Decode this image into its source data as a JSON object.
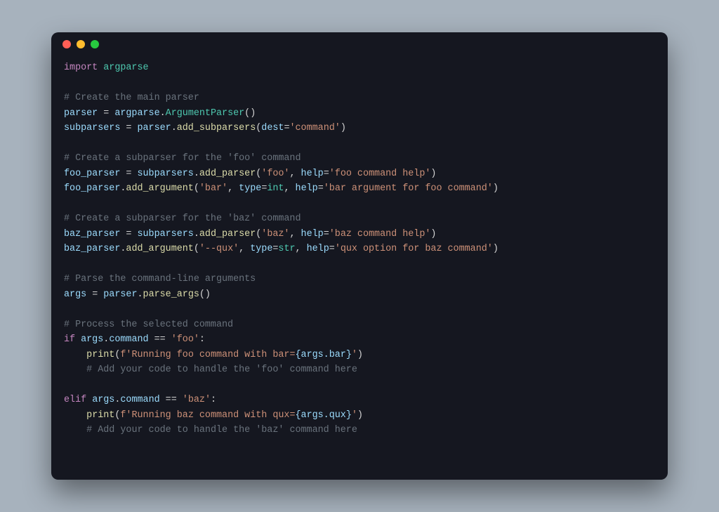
{
  "window": {
    "traffic_lights": [
      "close",
      "minimize",
      "zoom"
    ]
  },
  "code": {
    "lines": [
      [
        {
          "t": "import ",
          "c": "tk-kw"
        },
        {
          "t": "argparse",
          "c": "tk-mod"
        }
      ],
      [],
      [
        {
          "t": "# Create the main parser",
          "c": "tk-comment"
        }
      ],
      [
        {
          "t": "parser",
          "c": "tk-ident"
        },
        {
          "t": " = ",
          "c": "tk-op"
        },
        {
          "t": "argparse",
          "c": "tk-ident"
        },
        {
          "t": ".",
          "c": "tk-op"
        },
        {
          "t": "ArgumentParser",
          "c": "tk-mod"
        },
        {
          "t": "()",
          "c": "tk-op"
        }
      ],
      [
        {
          "t": "subparsers",
          "c": "tk-ident"
        },
        {
          "t": " = ",
          "c": "tk-op"
        },
        {
          "t": "parser",
          "c": "tk-ident"
        },
        {
          "t": ".",
          "c": "tk-op"
        },
        {
          "t": "add_subparsers",
          "c": "tk-func"
        },
        {
          "t": "(",
          "c": "tk-op"
        },
        {
          "t": "dest",
          "c": "tk-param"
        },
        {
          "t": "=",
          "c": "tk-op"
        },
        {
          "t": "'command'",
          "c": "tk-str"
        },
        {
          "t": ")",
          "c": "tk-op"
        }
      ],
      [],
      [
        {
          "t": "# Create a subparser for the 'foo' command",
          "c": "tk-comment"
        }
      ],
      [
        {
          "t": "foo_parser",
          "c": "tk-ident"
        },
        {
          "t": " = ",
          "c": "tk-op"
        },
        {
          "t": "subparsers",
          "c": "tk-ident"
        },
        {
          "t": ".",
          "c": "tk-op"
        },
        {
          "t": "add_parser",
          "c": "tk-func"
        },
        {
          "t": "(",
          "c": "tk-op"
        },
        {
          "t": "'foo'",
          "c": "tk-str"
        },
        {
          "t": ", ",
          "c": "tk-op"
        },
        {
          "t": "help",
          "c": "tk-param"
        },
        {
          "t": "=",
          "c": "tk-op"
        },
        {
          "t": "'foo command help'",
          "c": "tk-str"
        },
        {
          "t": ")",
          "c": "tk-op"
        }
      ],
      [
        {
          "t": "foo_parser",
          "c": "tk-ident"
        },
        {
          "t": ".",
          "c": "tk-op"
        },
        {
          "t": "add_argument",
          "c": "tk-func"
        },
        {
          "t": "(",
          "c": "tk-op"
        },
        {
          "t": "'bar'",
          "c": "tk-str"
        },
        {
          "t": ", ",
          "c": "tk-op"
        },
        {
          "t": "type",
          "c": "tk-param"
        },
        {
          "t": "=",
          "c": "tk-op"
        },
        {
          "t": "int",
          "c": "tk-mod"
        },
        {
          "t": ", ",
          "c": "tk-op"
        },
        {
          "t": "help",
          "c": "tk-param"
        },
        {
          "t": "=",
          "c": "tk-op"
        },
        {
          "t": "'bar argument for foo command'",
          "c": "tk-str"
        },
        {
          "t": ")",
          "c": "tk-op"
        }
      ],
      [],
      [
        {
          "t": "# Create a subparser for the 'baz' command",
          "c": "tk-comment"
        }
      ],
      [
        {
          "t": "baz_parser",
          "c": "tk-ident"
        },
        {
          "t": " = ",
          "c": "tk-op"
        },
        {
          "t": "subparsers",
          "c": "tk-ident"
        },
        {
          "t": ".",
          "c": "tk-op"
        },
        {
          "t": "add_parser",
          "c": "tk-func"
        },
        {
          "t": "(",
          "c": "tk-op"
        },
        {
          "t": "'baz'",
          "c": "tk-str"
        },
        {
          "t": ", ",
          "c": "tk-op"
        },
        {
          "t": "help",
          "c": "tk-param"
        },
        {
          "t": "=",
          "c": "tk-op"
        },
        {
          "t": "'baz command help'",
          "c": "tk-str"
        },
        {
          "t": ")",
          "c": "tk-op"
        }
      ],
      [
        {
          "t": "baz_parser",
          "c": "tk-ident"
        },
        {
          "t": ".",
          "c": "tk-op"
        },
        {
          "t": "add_argument",
          "c": "tk-func"
        },
        {
          "t": "(",
          "c": "tk-op"
        },
        {
          "t": "'--qux'",
          "c": "tk-str"
        },
        {
          "t": ", ",
          "c": "tk-op"
        },
        {
          "t": "type",
          "c": "tk-param"
        },
        {
          "t": "=",
          "c": "tk-op"
        },
        {
          "t": "str",
          "c": "tk-mod"
        },
        {
          "t": ", ",
          "c": "tk-op"
        },
        {
          "t": "help",
          "c": "tk-param"
        },
        {
          "t": "=",
          "c": "tk-op"
        },
        {
          "t": "'qux option for baz command'",
          "c": "tk-str"
        },
        {
          "t": ")",
          "c": "tk-op"
        }
      ],
      [],
      [
        {
          "t": "# Parse the command-line arguments",
          "c": "tk-comment"
        }
      ],
      [
        {
          "t": "args",
          "c": "tk-ident"
        },
        {
          "t": " = ",
          "c": "tk-op"
        },
        {
          "t": "parser",
          "c": "tk-ident"
        },
        {
          "t": ".",
          "c": "tk-op"
        },
        {
          "t": "parse_args",
          "c": "tk-func"
        },
        {
          "t": "()",
          "c": "tk-op"
        }
      ],
      [],
      [
        {
          "t": "# Process the selected command",
          "c": "tk-comment"
        }
      ],
      [
        {
          "t": "if ",
          "c": "tk-kw"
        },
        {
          "t": "args",
          "c": "tk-ident"
        },
        {
          "t": ".",
          "c": "tk-op"
        },
        {
          "t": "command",
          "c": "tk-ident"
        },
        {
          "t": " == ",
          "c": "tk-op"
        },
        {
          "t": "'foo'",
          "c": "tk-str"
        },
        {
          "t": ":",
          "c": "tk-op"
        }
      ],
      [
        {
          "t": "    ",
          "c": "tk-op"
        },
        {
          "t": "print",
          "c": "tk-func"
        },
        {
          "t": "(",
          "c": "tk-op"
        },
        {
          "t": "f'Running foo command with bar=",
          "c": "tk-str"
        },
        {
          "t": "{args.bar}",
          "c": "tk-fsub"
        },
        {
          "t": "'",
          "c": "tk-str"
        },
        {
          "t": ")",
          "c": "tk-op"
        }
      ],
      [
        {
          "t": "    ",
          "c": "tk-op"
        },
        {
          "t": "# Add your code to handle the 'foo' command here",
          "c": "tk-comment"
        }
      ],
      [],
      [
        {
          "t": "elif ",
          "c": "tk-kw"
        },
        {
          "t": "args",
          "c": "tk-ident"
        },
        {
          "t": ".",
          "c": "tk-op"
        },
        {
          "t": "command",
          "c": "tk-ident"
        },
        {
          "t": " == ",
          "c": "tk-op"
        },
        {
          "t": "'baz'",
          "c": "tk-str"
        },
        {
          "t": ":",
          "c": "tk-op"
        }
      ],
      [
        {
          "t": "    ",
          "c": "tk-op"
        },
        {
          "t": "print",
          "c": "tk-func"
        },
        {
          "t": "(",
          "c": "tk-op"
        },
        {
          "t": "f'Running baz command with qux=",
          "c": "tk-str"
        },
        {
          "t": "{args.qux}",
          "c": "tk-fsub"
        },
        {
          "t": "'",
          "c": "tk-str"
        },
        {
          "t": ")",
          "c": "tk-op"
        }
      ],
      [
        {
          "t": "    ",
          "c": "tk-op"
        },
        {
          "t": "# Add your code to handle the 'baz' command here",
          "c": "tk-comment"
        }
      ]
    ]
  }
}
